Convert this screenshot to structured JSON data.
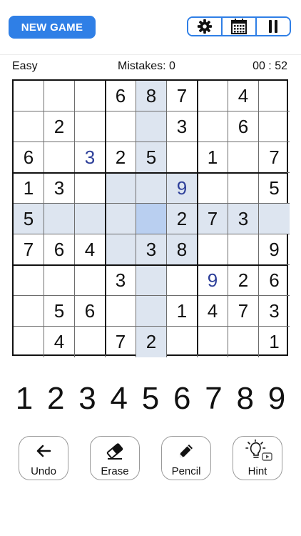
{
  "header": {
    "new_game_label": "NEW GAME",
    "tools": [
      {
        "name": "settings",
        "icon": "gear-icon"
      },
      {
        "name": "calendar",
        "icon": "calendar-icon"
      },
      {
        "name": "pause",
        "icon": "pause-icon"
      }
    ],
    "accent_color": "#2f7fe6"
  },
  "status": {
    "difficulty": "Easy",
    "mistakes": "Mistakes: 0",
    "timer": "00 : 52"
  },
  "board": {
    "selected": [
      4,
      4
    ],
    "rows": [
      [
        "",
        "",
        "",
        "6",
        "8",
        "7",
        "",
        "4",
        ""
      ],
      [
        "",
        "2",
        "",
        "",
        "",
        "3",
        "",
        "6",
        ""
      ],
      [
        "6",
        "",
        "3",
        "2",
        "5",
        "",
        "1",
        "",
        "7"
      ],
      [
        "1",
        "3",
        "",
        "",
        "",
        "9",
        "",
        "",
        "5"
      ],
      [
        "5",
        "",
        "",
        "",
        "",
        "2",
        "7",
        "3",
        ""
      ],
      [
        "7",
        "6",
        "4",
        "",
        "3",
        "8",
        "",
        "",
        "9"
      ],
      [
        "",
        "",
        "",
        "3",
        "",
        "",
        "9",
        "2",
        "6"
      ],
      [
        "",
        "5",
        "6",
        "",
        "",
        "1",
        "4",
        "7",
        "3"
      ],
      [
        "",
        "4",
        "",
        "7",
        "2",
        "",
        "",
        "",
        "1"
      ]
    ],
    "user_entries": [
      [
        2,
        2
      ],
      [
        3,
        5
      ],
      [
        6,
        6
      ]
    ],
    "highlight_color": "#dde5f0",
    "selected_color": "#b9cff0",
    "user_color": "#2d3f99"
  },
  "numpad": [
    "1",
    "2",
    "3",
    "4",
    "5",
    "6",
    "7",
    "8",
    "9"
  ],
  "actions": [
    {
      "label": "Undo",
      "icon": "arrow-left-icon"
    },
    {
      "label": "Erase",
      "icon": "eraser-icon"
    },
    {
      "label": "Pencil",
      "icon": "pencil-icon"
    },
    {
      "label": "Hint",
      "icon": "lightbulb-icon"
    }
  ]
}
